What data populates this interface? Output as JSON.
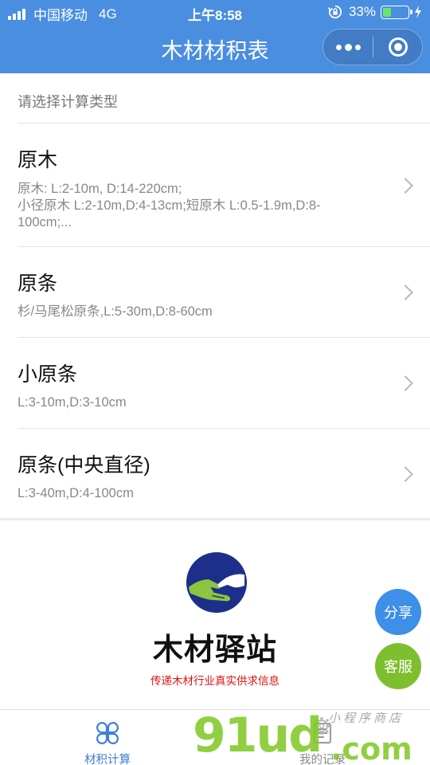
{
  "status_bar": {
    "carrier": "中国移动",
    "network": "4G",
    "time": "上午8:58",
    "battery_percent": "33%",
    "battery_level": 0.33
  },
  "navbar": {
    "title": "木材材积表"
  },
  "section_header": "请选择计算类型",
  "items": [
    {
      "name": "原木",
      "desc": "原木: L:2-10m, D:14-220cm;\n小径原木 L:2-10m,D:4-13cm;短原木 L:0.5-1.9m,D:8-100cm;..."
    },
    {
      "name": "原条",
      "desc": "杉/马尾松原条,L:5-30m,D:8-60cm"
    },
    {
      "name": "小原条",
      "desc": "L:3-10m,D:3-10cm"
    },
    {
      "name": "原条(中央直径)",
      "desc": "L:3-40m,D:4-100cm"
    }
  ],
  "brand": {
    "name": "木材驿站",
    "slogan": "传递木材行业真实供求信息"
  },
  "fab": {
    "share": "分享",
    "service": "客服"
  },
  "tabbar": {
    "tabs": [
      {
        "label": "材积计算",
        "icon": "clover-icon"
      },
      {
        "label": "我的记录",
        "icon": "records-icon"
      }
    ]
  },
  "watermark": {
    "main": "91ud",
    "dot": ".com",
    "sub": "小程序商店"
  },
  "colors": {
    "accent": "#4a8ee0",
    "tab_active": "#3d7fd6",
    "share_button": "#3d8fe8",
    "service_button": "#7dbf2e",
    "slogan": "#e01010",
    "watermark": "#82c828"
  }
}
